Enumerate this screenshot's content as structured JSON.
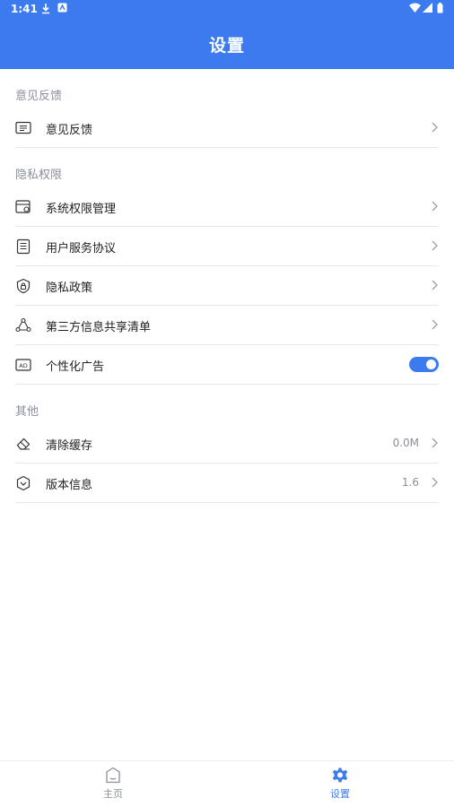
{
  "status_bar": {
    "time": "1:41"
  },
  "header": {
    "title": "设置"
  },
  "sections": [
    {
      "title": "意见反馈",
      "items": [
        {
          "label": "意见反馈",
          "icon": "chat-icon"
        }
      ]
    },
    {
      "title": "隐私权限",
      "items": [
        {
          "label": "系统权限管理",
          "icon": "permission-icon"
        },
        {
          "label": "用户服务协议",
          "icon": "document-icon"
        },
        {
          "label": "隐私政策",
          "icon": "shield-icon"
        },
        {
          "label": "第三方信息共享清单",
          "icon": "share-icon"
        },
        {
          "label": "个性化广告",
          "icon": "ad-icon",
          "toggle_on": true
        }
      ]
    },
    {
      "title": "其他",
      "items": [
        {
          "label": "清除缓存",
          "icon": "eraser-icon",
          "value": "0.0M"
        },
        {
          "label": "版本信息",
          "icon": "version-icon",
          "value": "1.6"
        }
      ]
    }
  ],
  "bottom_nav": {
    "home": "主页",
    "settings": "设置"
  },
  "colors": {
    "accent": "#3b7bef",
    "secondary_text": "#8a8f99",
    "divider": "#e6e8ec"
  }
}
